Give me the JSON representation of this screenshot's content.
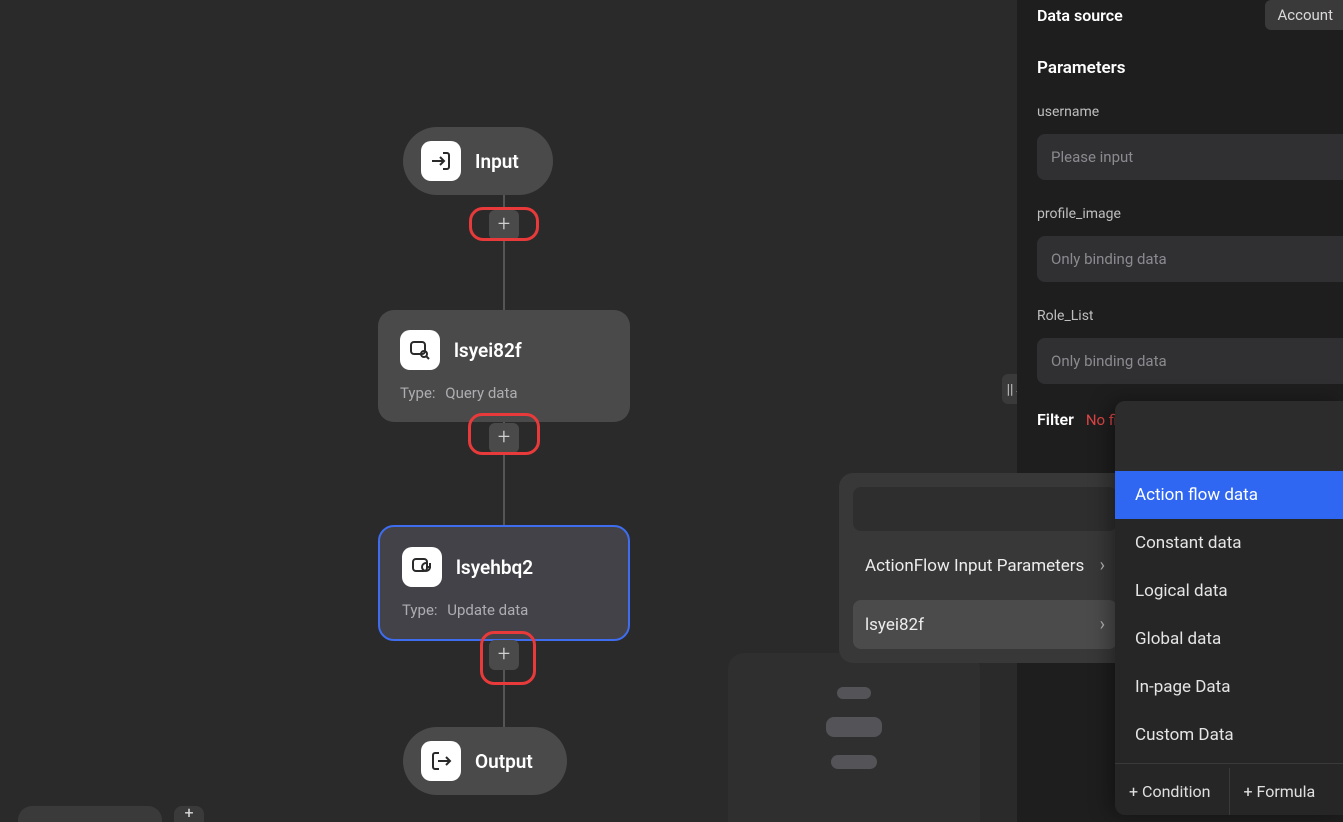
{
  "flow": {
    "input_label": "Input",
    "output_label": "Output",
    "nodes": [
      {
        "id": "n1",
        "title": "lsyei82f",
        "type_label": "Type:",
        "type_value": "Query data"
      },
      {
        "id": "n2",
        "title": "lsyehbq2",
        "type_label": "Type:",
        "type_value": "Update data"
      }
    ]
  },
  "side_panel": {
    "data_source_label": "Data source",
    "data_source_value": "Account",
    "parameters_title": "Parameters",
    "fields": [
      {
        "name": "username",
        "placeholder": "Please input"
      },
      {
        "name": "profile_image",
        "placeholder": "Only binding data"
      },
      {
        "name": "Role_List",
        "placeholder": "Only binding data"
      }
    ],
    "filter_label": "Filter",
    "filter_warning": "No fi"
  },
  "popover_params": {
    "items": [
      {
        "label": "ActionFlow Input Parameters"
      },
      {
        "label": "lsyei82f"
      }
    ]
  },
  "popover_types": {
    "options": [
      "Action flow data",
      "Constant data",
      "Logical data",
      "Global data",
      "In-page Data",
      "Custom Data"
    ],
    "actions": {
      "condition": "+ Condition",
      "formula": "+ Formula"
    }
  },
  "collapse_glyph": "||←",
  "bottom_plus": "+"
}
